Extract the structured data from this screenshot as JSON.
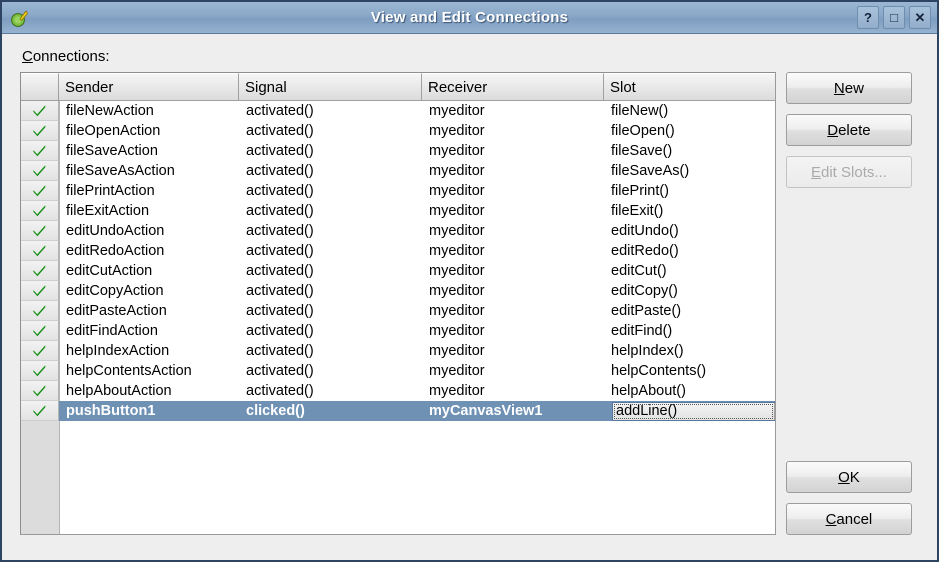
{
  "window": {
    "title": "View and Edit Connections",
    "icon": "qt-logo-icon",
    "titlebar_buttons": [
      {
        "name": "help-button",
        "glyph": "?"
      },
      {
        "name": "maximize-button",
        "glyph": "□"
      },
      {
        "name": "close-button",
        "glyph": "✕"
      }
    ]
  },
  "labels": {
    "connections_mnemonic": "C",
    "connections_rest": "onnections:"
  },
  "table": {
    "columns": [
      "Sender",
      "Signal",
      "Receiver",
      "Slot"
    ],
    "rows": [
      {
        "checked": true,
        "sender": "fileNewAction",
        "signal": "activated()",
        "receiver": "myeditor",
        "slot": "fileNew()"
      },
      {
        "checked": true,
        "sender": "fileOpenAction",
        "signal": "activated()",
        "receiver": "myeditor",
        "slot": "fileOpen()"
      },
      {
        "checked": true,
        "sender": "fileSaveAction",
        "signal": "activated()",
        "receiver": "myeditor",
        "slot": "fileSave()"
      },
      {
        "checked": true,
        "sender": "fileSaveAsAction",
        "signal": "activated()",
        "receiver": "myeditor",
        "slot": "fileSaveAs()"
      },
      {
        "checked": true,
        "sender": "filePrintAction",
        "signal": "activated()",
        "receiver": "myeditor",
        "slot": "filePrint()"
      },
      {
        "checked": true,
        "sender": "fileExitAction",
        "signal": "activated()",
        "receiver": "myeditor",
        "slot": "fileExit()"
      },
      {
        "checked": true,
        "sender": "editUndoAction",
        "signal": "activated()",
        "receiver": "myeditor",
        "slot": "editUndo()"
      },
      {
        "checked": true,
        "sender": "editRedoAction",
        "signal": "activated()",
        "receiver": "myeditor",
        "slot": "editRedo()"
      },
      {
        "checked": true,
        "sender": "editCutAction",
        "signal": "activated()",
        "receiver": "myeditor",
        "slot": "editCut()"
      },
      {
        "checked": true,
        "sender": "editCopyAction",
        "signal": "activated()",
        "receiver": "myeditor",
        "slot": "editCopy()"
      },
      {
        "checked": true,
        "sender": "editPasteAction",
        "signal": "activated()",
        "receiver": "myeditor",
        "slot": "editPaste()"
      },
      {
        "checked": true,
        "sender": "editFindAction",
        "signal": "activated()",
        "receiver": "myeditor",
        "slot": "editFind()"
      },
      {
        "checked": true,
        "sender": "helpIndexAction",
        "signal": "activated()",
        "receiver": "myeditor",
        "slot": "helpIndex()"
      },
      {
        "checked": true,
        "sender": "helpContentsAction",
        "signal": "activated()",
        "receiver": "myeditor",
        "slot": "helpContents()"
      },
      {
        "checked": true,
        "sender": "helpAboutAction",
        "signal": "activated()",
        "receiver": "myeditor",
        "slot": "helpAbout()"
      }
    ],
    "selected_row": {
      "checked": true,
      "sender": "pushButton1",
      "signal": "clicked()",
      "receiver": "myCanvasView1",
      "slot_value": "addLine()"
    }
  },
  "buttons": {
    "new": {
      "mnemonic": "N",
      "rest": "ew",
      "enabled": true
    },
    "delete": {
      "mnemonic": "D",
      "rest": "elete",
      "enabled": true
    },
    "edit_slots": {
      "mnemonic": "E",
      "rest": "dit Slots...",
      "enabled": false
    },
    "ok": {
      "mnemonic": "O",
      "rest": "K",
      "enabled": true
    },
    "cancel": {
      "mnemonic": "C",
      "rest": "ancel",
      "enabled": true
    }
  },
  "colors": {
    "titlebar": "#8fabc9",
    "selection": "#6f91b4",
    "dialog_bg": "#eeeeee",
    "border": "#2d4463",
    "check_green": "#159015"
  }
}
